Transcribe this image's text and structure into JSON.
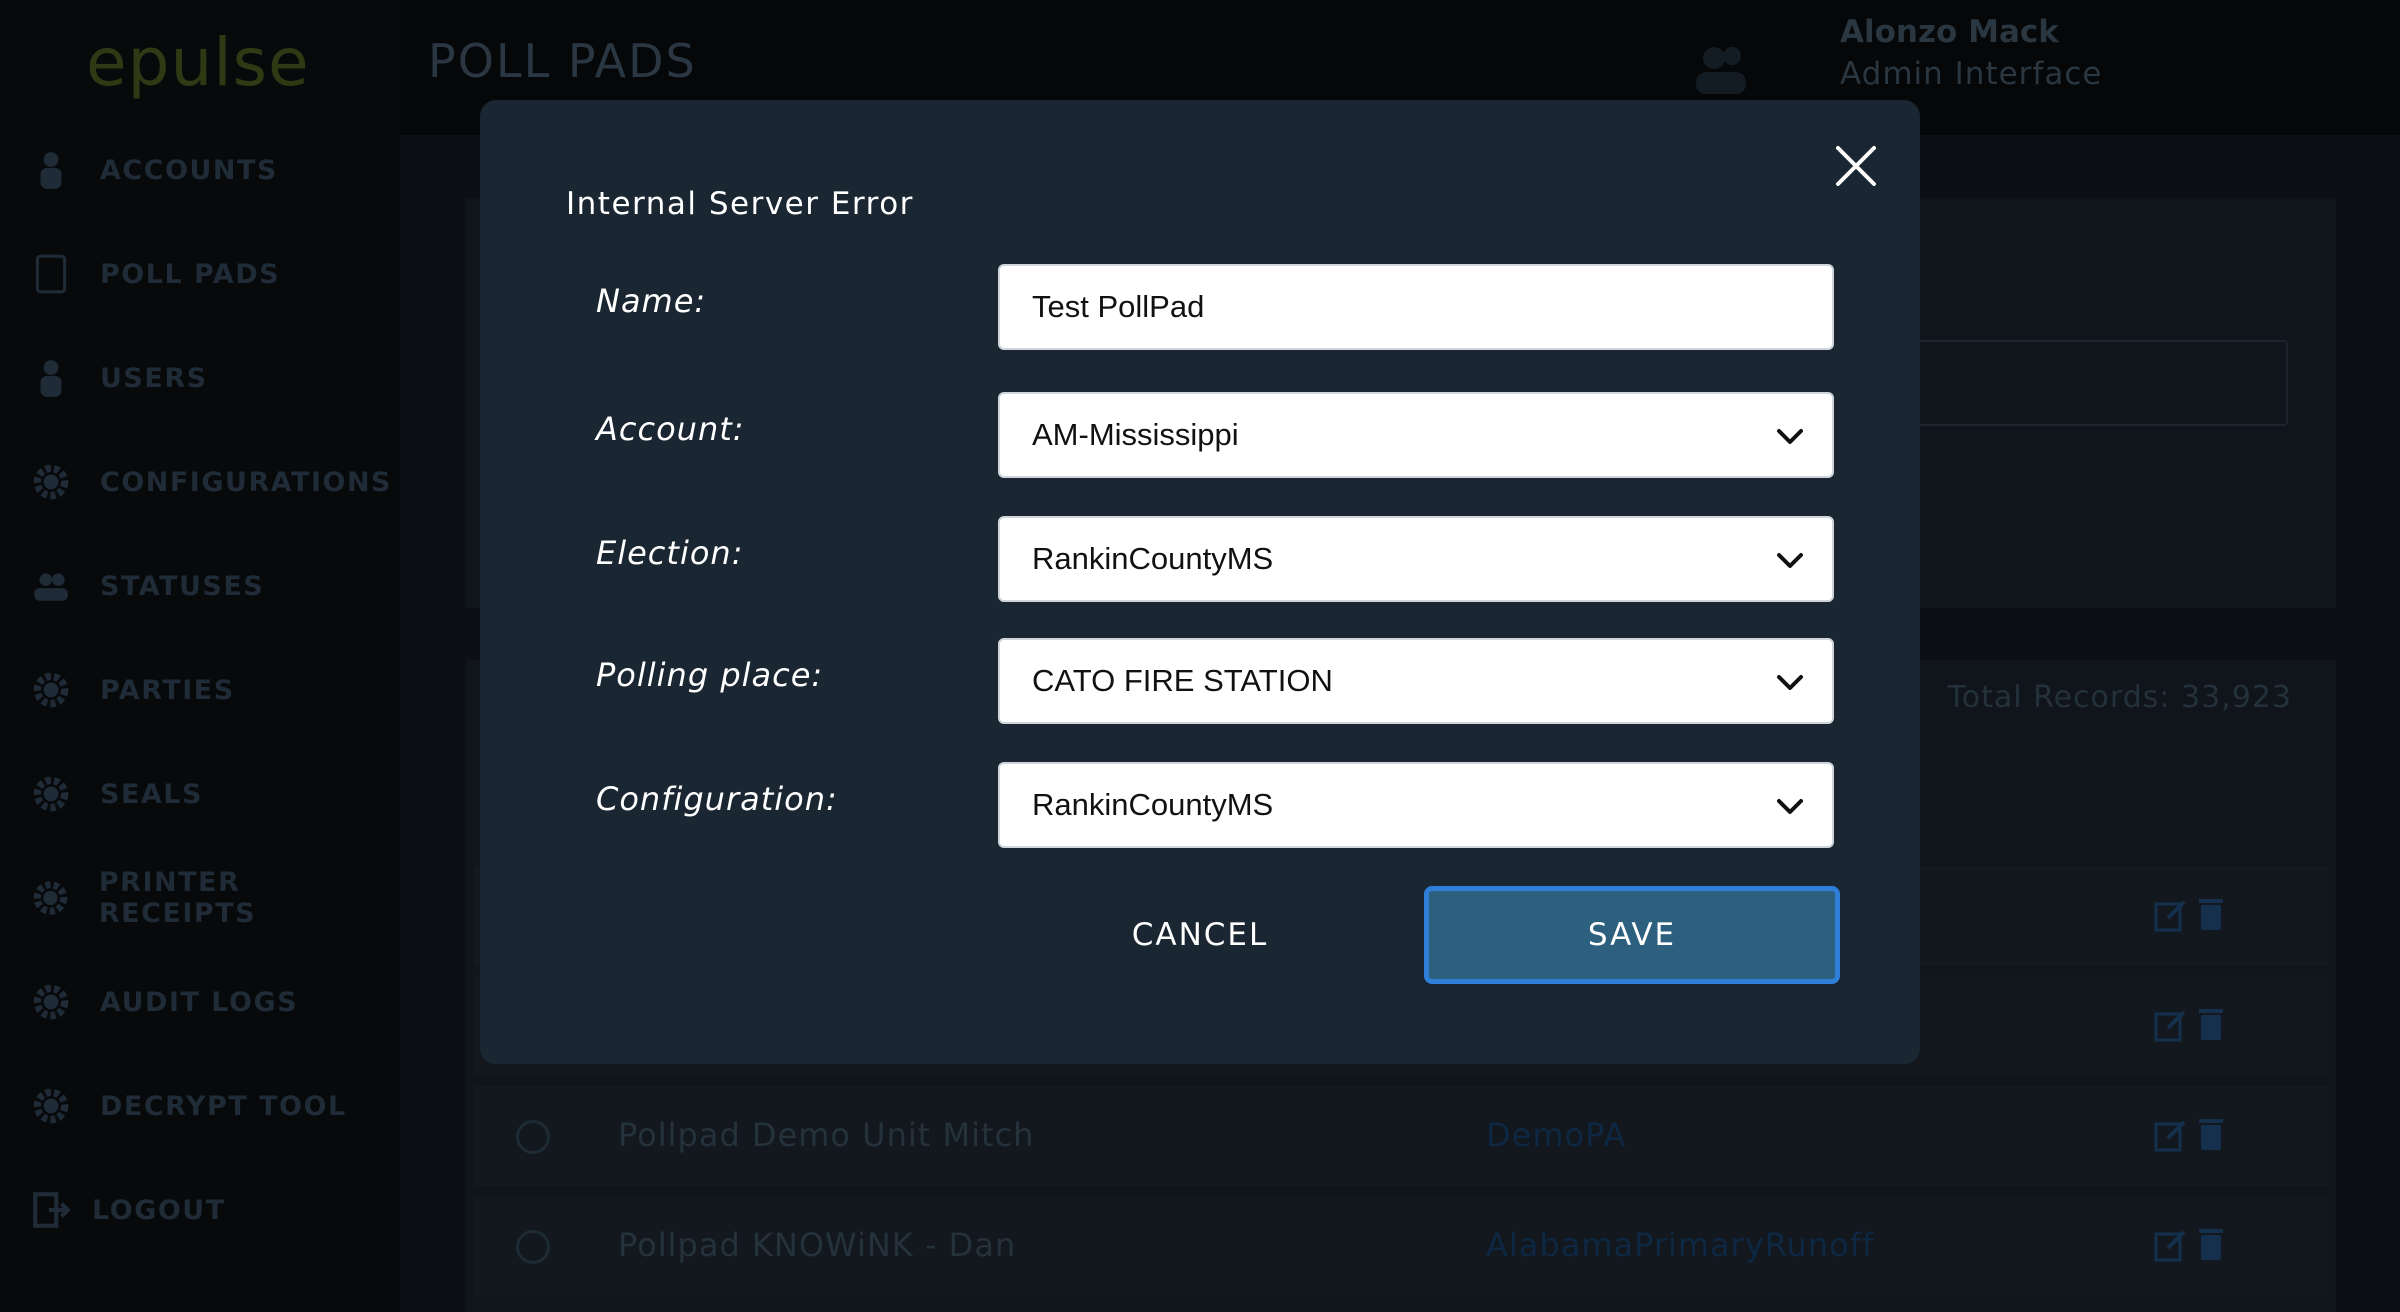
{
  "app": {
    "logo_text": "epulse",
    "page_title": "POLL PADS",
    "user": {
      "name": "Alonzo Mack",
      "role": "Admin Interface"
    }
  },
  "sidebar": {
    "items": [
      {
        "label": "ACCOUNTS",
        "icon": "accounts-icon"
      },
      {
        "label": "POLL PADS",
        "icon": "tablet-icon"
      },
      {
        "label": "USERS",
        "icon": "users-icon"
      },
      {
        "label": "CONFIGURATIONS",
        "icon": "gear-icon"
      },
      {
        "label": "STATUSES",
        "icon": "people-icon"
      },
      {
        "label": "PARTIES",
        "icon": "gear-icon"
      },
      {
        "label": "SEALS",
        "icon": "gear-icon"
      },
      {
        "label": "PRINTER RECEIPTS",
        "icon": "gear-icon"
      },
      {
        "label": "AUDIT LOGS",
        "icon": "gear-icon"
      },
      {
        "label": "DECRYPT TOOL",
        "icon": "gear-icon"
      },
      {
        "label": "LOGOUT",
        "icon": "logout-icon"
      }
    ]
  },
  "list": {
    "total_records": "Total Records: 33,923",
    "rows": [
      {
        "name": "",
        "election": ""
      },
      {
        "name": "",
        "election": ""
      },
      {
        "name": "Pollpad Demo Unit Mitch",
        "election": "DemoPA"
      },
      {
        "name": "Pollpad KNOWiNK - Dan",
        "election": "AlabamaPrimaryRunoff"
      }
    ]
  },
  "modal": {
    "error_message": "Internal Server Error",
    "fields": {
      "name": {
        "label": "Name:",
        "value": "Test PollPad"
      },
      "account": {
        "label": "Account:",
        "value": "AM-Mississippi"
      },
      "election": {
        "label": "Election:",
        "value": "RankinCountyMS"
      },
      "polling_place": {
        "label": "Polling place:",
        "value": "CATO FIRE STATION"
      },
      "configuration": {
        "label": "Configuration:",
        "value": "RankinCountyMS"
      }
    },
    "cancel_label": "CANCEL",
    "save_label": "SAVE"
  },
  "colors": {
    "modal_bg": "#1a2631",
    "save_button": "#2d607f",
    "save_focus_ring": "#2f7fd8"
  }
}
